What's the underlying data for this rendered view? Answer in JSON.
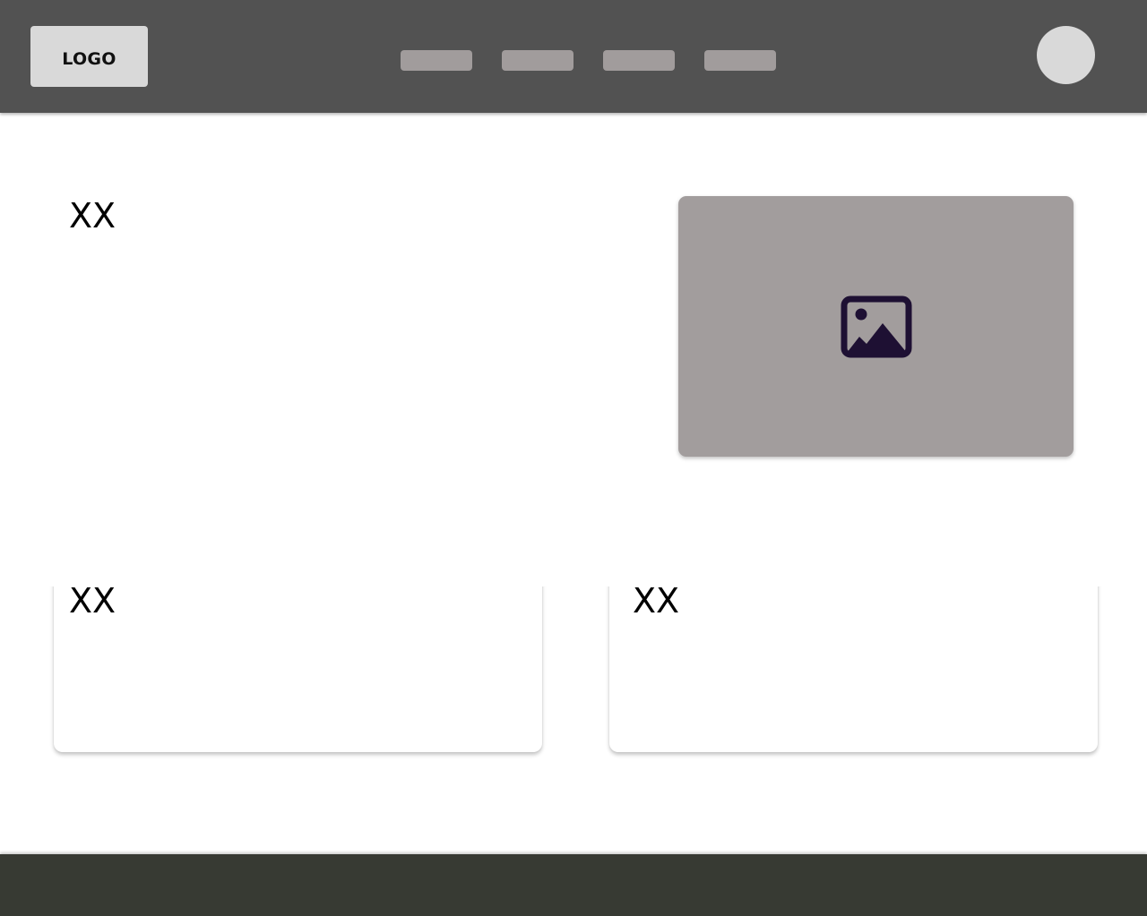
{
  "colors": {
    "header_bg": "#525252",
    "logo_bg": "#d9d9d9",
    "nav_pill": "#a19c9c",
    "avatar": "#d9d9d9",
    "image_placeholder_bg": "#a29d9d",
    "image_icon": "#1e1033",
    "footer_bg": "#373a33"
  },
  "header": {
    "logo_text": "LOGO",
    "nav_items": [
      "",
      "",
      "",
      ""
    ],
    "avatar_icon": "avatar-circle"
  },
  "hero": {
    "title": "XX",
    "image_icon": "image-placeholder-icon"
  },
  "cards": [
    {
      "title": "XX"
    },
    {
      "title": "XX"
    }
  ],
  "footer": {}
}
